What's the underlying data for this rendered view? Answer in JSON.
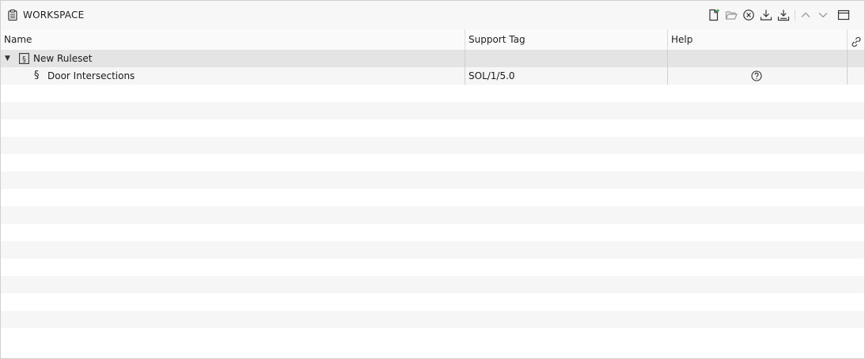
{
  "panel": {
    "title": "WORKSPACE",
    "title_icon": "clipboard-icon"
  },
  "toolbar": {
    "buttons": [
      {
        "name": "new-file-button",
        "icon": "new-file-icon"
      },
      {
        "name": "open-folder-button",
        "icon": "folder-open-icon"
      },
      {
        "name": "close-button",
        "icon": "close-circle-icon"
      },
      {
        "name": "download-button",
        "icon": "download-icon"
      },
      {
        "name": "download-all-button",
        "icon": "download-tray-icon"
      },
      {
        "name": "move-up-button",
        "icon": "chevron-up-icon"
      },
      {
        "name": "move-down-button",
        "icon": "chevron-down-icon"
      },
      {
        "name": "maximize-button",
        "icon": "window-icon"
      }
    ]
  },
  "table": {
    "columns": [
      "Name",
      "Support Tag",
      "Help"
    ],
    "link_column_icon": "link-icon",
    "rows": [
      {
        "name": "New Ruleset",
        "support_tag": "",
        "expanded": true,
        "icon": "ruleset-icon",
        "selected": true
      },
      {
        "name": "Door Intersections",
        "support_tag": "SOL/1/5.0",
        "icon": "section-icon",
        "help_icon": "help-circle-icon"
      }
    ]
  },
  "colors": {
    "selected_row": "#e4e4e4",
    "stripe_row": "#f6f6f6",
    "header_bg": "#f7f7f7",
    "accent_green": "#3aa657"
  }
}
